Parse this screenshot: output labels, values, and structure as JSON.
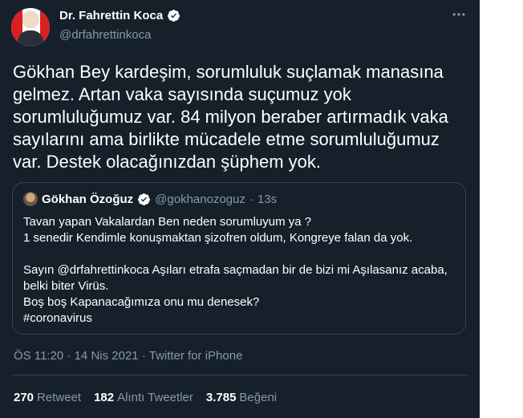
{
  "author": {
    "display_name": "Dr. Fahrettin Koca",
    "handle": "@drfahrettinkoca"
  },
  "tweet": {
    "text": "Gökhan Bey kardeşim, sorumluluk suçlamak manasına gelmez. Artan vaka sayısında suçumuz yok sorumluluğumuz var. 84 milyon beraber artırmadık vaka sayılarını ama birlikte mücadele etme sorumluluğumuz var. Destek olacağınızdan şüphem yok."
  },
  "quoted": {
    "display_name": "Gökhan Özoğuz",
    "handle": "@gokhanozoguz",
    "separator": "·",
    "time": "13s",
    "text": "Tavan yapan Vakalardan Ben neden sorumluyum ya ?\n1 senedir Kendimle konuşmaktan şizofren oldum, Kongreye falan da yok.\n\nSayın @drfahrettinkoca Aşıları etrafa saçmadan bir de bizi mi Aşılasanız acaba, belki biter Virüs.\nBoş boş Kapanacağımıza onu mu denesek?\n#coronavirus"
  },
  "meta": "ÖS 11:20 · 14 Nis 2021 · Twitter for iPhone",
  "stats": [
    {
      "count": "270",
      "label": "Retweet"
    },
    {
      "count": "182",
      "label": "Alıntı Tweetler"
    },
    {
      "count": "3.785",
      "label": "Beğeni"
    }
  ],
  "icons": {
    "verified": "verified-badge-icon",
    "more": "more-options-icon"
  },
  "colors": {
    "background": "#15202b",
    "secondary_text": "#8899a6",
    "verified": "#ffffff",
    "border": "#38444d"
  }
}
